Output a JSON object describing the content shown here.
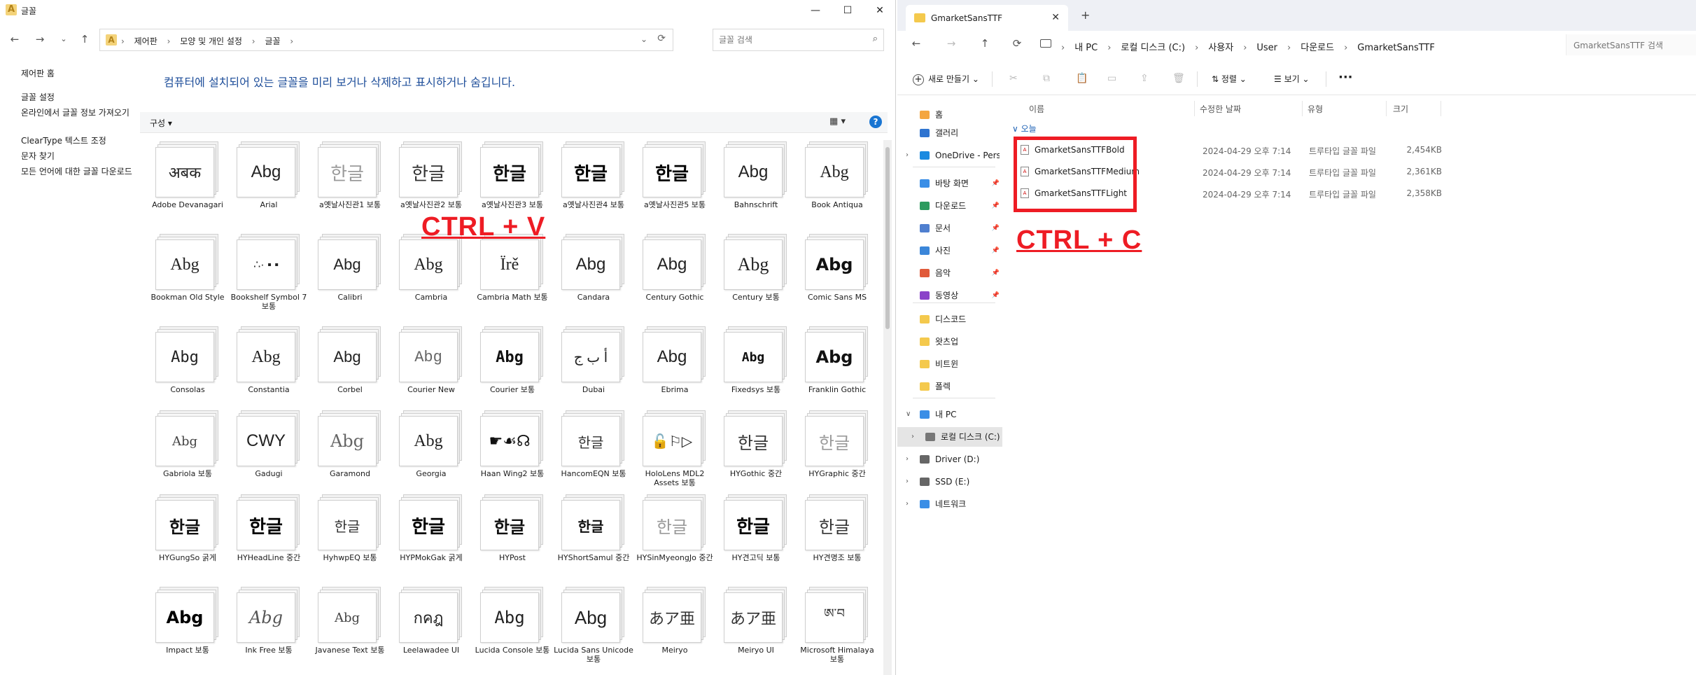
{
  "left_window": {
    "title": "글꼴",
    "buttons": {
      "minimize": "—",
      "maximize": "☐",
      "close": "✕"
    },
    "nav": {
      "back": "←",
      "forward": "→",
      "recent": "⌄",
      "up": "↑"
    },
    "address": {
      "crumbs": [
        "제어판",
        "모양 및 개인 설정",
        "글꼴"
      ],
      "separator": "›"
    },
    "search": {
      "placeholder": "글꼴 검색"
    },
    "sidebar": [
      "제어판 홈",
      "글꼴 설정",
      "온라인에서 글꼴 정보 가져오기",
      "ClearType 텍스트 조정",
      "문자 찾기",
      "모든 언어에 대한 글꼴 다운로드"
    ],
    "heading": "컴퓨터에 설치되어 있는 글꼴을 미리 보거나 삭제하고 표시하거나 숨깁니다.",
    "toolbar": {
      "organize": "구성 ▾",
      "view": "▦ ▾",
      "help": "?"
    },
    "fonts": [
      {
        "name": "Adobe Devanagari",
        "sample": "अबक",
        "style": "serif",
        "size": 22
      },
      {
        "name": "Arial",
        "sample": "Abg",
        "style": "sans",
        "size": 24
      },
      {
        "name": "a옛날사진관1 보통",
        "sample": "한글",
        "style": "light",
        "size": 26
      },
      {
        "name": "a옛날사진관2 보통",
        "sample": "한글",
        "style": "regular",
        "size": 26
      },
      {
        "name": "a옛날사진관3 보통",
        "sample": "한글",
        "style": "bold",
        "size": 26
      },
      {
        "name": "a옛날사진관4 보통",
        "sample": "한글",
        "style": "heavy",
        "size": 26
      },
      {
        "name": "a옛날사진관5 보통",
        "sample": "한글",
        "style": "heavy",
        "size": 26
      },
      {
        "name": "Bahnschrift",
        "sample": "Abg",
        "style": "sans",
        "size": 24
      },
      {
        "name": "Book Antiqua",
        "sample": "Abg",
        "style": "serif",
        "size": 24
      },
      {
        "name": "Bookman Old Style",
        "sample": "Abg",
        "style": "serif",
        "size": 24
      },
      {
        "name": "Bookshelf Symbol 7 보통",
        "sample": "∴·  ▪  ▪",
        "style": "sans",
        "size": 16
      },
      {
        "name": "Calibri",
        "sample": "Abg",
        "style": "sans",
        "size": 22
      },
      {
        "name": "Cambria",
        "sample": "Abg",
        "style": "serif",
        "size": 24
      },
      {
        "name": "Cambria Math 보통",
        "sample": "Ïrě",
        "style": "serif",
        "size": 24
      },
      {
        "name": "Candara",
        "sample": "Abg",
        "style": "sans",
        "size": 24
      },
      {
        "name": "Century Gothic",
        "sample": "Abg",
        "style": "sans",
        "size": 24
      },
      {
        "name": "Century 보통",
        "sample": "Abg",
        "style": "serif",
        "size": 26
      },
      {
        "name": "Comic Sans MS",
        "sample": "Abg",
        "style": "sans-bold",
        "size": 24
      },
      {
        "name": "Consolas",
        "sample": "Abg",
        "style": "mono",
        "size": 22
      },
      {
        "name": "Constantia",
        "sample": "Abg",
        "style": "serif",
        "size": 24
      },
      {
        "name": "Corbel",
        "sample": "Abg",
        "style": "sans",
        "size": 22
      },
      {
        "name": "Courier New",
        "sample": "Abg",
        "style": "mono-light",
        "size": 22
      },
      {
        "name": "Courier 보통",
        "sample": "Abg",
        "style": "mono-bold",
        "size": 22
      },
      {
        "name": "Dubai",
        "sample": "أ ب ج",
        "style": "sans",
        "size": 20
      },
      {
        "name": "Ebrima",
        "sample": "Abg",
        "style": "sans",
        "size": 24
      },
      {
        "name": "Fixedsys 보통",
        "sample": "Abg",
        "style": "mono-bold",
        "size": 18
      },
      {
        "name": "Franklin Gothic",
        "sample": "Abg",
        "style": "sans-bold",
        "size": 24
      },
      {
        "name": "Gabriola 보통",
        "sample": "Abg",
        "style": "serif-small",
        "size": 18
      },
      {
        "name": "Gadugi",
        "sample": "CWY",
        "style": "sans",
        "size": 24
      },
      {
        "name": "Garamond",
        "sample": "Abg",
        "style": "serif-light",
        "size": 24
      },
      {
        "name": "Georgia",
        "sample": "Abg",
        "style": "serif",
        "size": 24
      },
      {
        "name": "Haan Wing2 보통",
        "sample": "☛☙☊",
        "style": "sans-bold",
        "size": 22
      },
      {
        "name": "HancomEQN 보통",
        "sample": "한글",
        "style": "regular",
        "size": 20
      },
      {
        "name": "HoloLens MDL2 Assets 보통",
        "sample": "🔓⚐▷",
        "style": "sans",
        "size": 20
      },
      {
        "name": "HYGothic 중간",
        "sample": "한글",
        "style": "regular",
        "size": 24
      },
      {
        "name": "HYGraphic 중간",
        "sample": "한글",
        "style": "light",
        "size": 24
      },
      {
        "name": "HYGungSo 굵게",
        "sample": "한글",
        "style": "bold",
        "size": 24
      },
      {
        "name": "HYHeadLine 중간",
        "sample": "한글",
        "style": "heavy",
        "size": 26
      },
      {
        "name": "HyhwpEQ 보통",
        "sample": "한글",
        "style": "regular",
        "size": 20
      },
      {
        "name": "HYPMokGak 굵게",
        "sample": "한글",
        "style": "heavy",
        "size": 26
      },
      {
        "name": "HYPost",
        "sample": "한글",
        "style": "bold",
        "size": 24
      },
      {
        "name": "HYShortSamul 중간",
        "sample": "한글",
        "style": "bold",
        "size": 20
      },
      {
        "name": "HYSinMyeongJo 중간",
        "sample": "한글",
        "style": "light",
        "size": 24
      },
      {
        "name": "HY견고딕 보통",
        "sample": "한글",
        "style": "heavy",
        "size": 26
      },
      {
        "name": "HY견명조 보통",
        "sample": "한글",
        "style": "regular",
        "size": 24
      },
      {
        "name": "Impact 보통",
        "sample": "Abg",
        "style": "heavy",
        "size": 24
      },
      {
        "name": "Ink Free 보통",
        "sample": "Abg",
        "style": "italic-light",
        "size": 24
      },
      {
        "name": "Javanese Text 보통",
        "sample": "Abg",
        "style": "serif-small",
        "size": 18
      },
      {
        "name": "Leelawadee UI",
        "sample": "กคฎ",
        "style": "sans",
        "size": 22
      },
      {
        "name": "Lucida Console 보통",
        "sample": "Abg",
        "style": "mono",
        "size": 24
      },
      {
        "name": "Lucida Sans Unicode 보통",
        "sample": "Abg",
        "style": "sans",
        "size": 26
      },
      {
        "name": "Meiryo",
        "sample": "あア亜",
        "style": "regular",
        "size": 22
      },
      {
        "name": "Meiryo UI",
        "sample": "あア亜",
        "style": "regular",
        "size": 22
      },
      {
        "name": "Microsoft Himalaya 보통",
        "sample": "ཨ་བ",
        "style": "regular",
        "size": 18
      }
    ],
    "overlay_text": "CTRL + V"
  },
  "right_window": {
    "tab": {
      "title": "GmarketSansTTF",
      "close": "✕",
      "new_tab": "+"
    },
    "nav": {
      "back": "←",
      "forward": "→",
      "up": "↑",
      "refresh": "⟳"
    },
    "address": {
      "crumbs": [
        "내 PC",
        "로컬 디스크 (C:)",
        "사용자",
        "User",
        "다운로드",
        "GmarketSansTTF"
      ],
      "separator": "›"
    },
    "search": {
      "placeholder": "GmarketSansTTF 검색"
    },
    "cmdbar": {
      "new_label": "새로 만들기",
      "sort_label": "⇅ 정렬 ⌄",
      "view_label": "☰ 보기 ⌄",
      "more": "···"
    },
    "nav_items": [
      {
        "label": "홈",
        "color": "#f4a640",
        "pin": false,
        "chev": false
      },
      {
        "label": "갤러리",
        "color": "#2f74d0",
        "pin": false,
        "chev": false
      },
      {
        "label": "OneDrive - Personal",
        "color": "#1b8ae0",
        "pin": false,
        "chev": true
      },
      {
        "label": "바탕 화면",
        "color": "#3a8ee6",
        "pin": true,
        "chev": false
      },
      {
        "label": "다운로드",
        "color": "#2d9b5e",
        "pin": true,
        "chev": false
      },
      {
        "label": "문서",
        "color": "#4f7fcf",
        "pin": true,
        "chev": false
      },
      {
        "label": "사진",
        "color": "#3b86d9",
        "pin": true,
        "chev": false
      },
      {
        "label": "음악",
        "color": "#e05a3a",
        "pin": true,
        "chev": false
      },
      {
        "label": "동영상",
        "color": "#8a43c9",
        "pin": true,
        "chev": false
      },
      {
        "label": "디스코드",
        "color": "#f4c94d",
        "pin": false,
        "chev": false
      },
      {
        "label": "왓츠업",
        "color": "#f4c94d",
        "pin": false,
        "chev": false
      },
      {
        "label": "비트윈",
        "color": "#f4c94d",
        "pin": false,
        "chev": false
      },
      {
        "label": "폴렉",
        "color": "#f4c94d",
        "pin": false,
        "chev": false
      },
      {
        "label": "내 PC",
        "color": "#3a8ee6",
        "pin": false,
        "chev": true,
        "expanded": true
      },
      {
        "label": "로컬 디스크 (C:)",
        "color": "#777777",
        "pin": false,
        "chev": true,
        "selected": true
      },
      {
        "label": "Driver (D:)",
        "color": "#666666",
        "pin": false,
        "chev": true
      },
      {
        "label": "SSD (E:)",
        "color": "#666666",
        "pin": false,
        "chev": true
      },
      {
        "label": "네트워크",
        "color": "#3a8ee6",
        "pin": false,
        "chev": true
      }
    ],
    "columns": [
      "이름",
      "수정한 날짜",
      "유형",
      "크기"
    ],
    "group_label": "∨ 오늘",
    "files": [
      {
        "name": "GmarketSansTTFBold",
        "date": "2024-04-29 오후 7:14",
        "type": "트루타입 글꼴 파일",
        "size": "2,454KB"
      },
      {
        "name": "GmarketSansTTFMedium",
        "date": "2024-04-29 오후 7:14",
        "type": "트루타입 글꼴 파일",
        "size": "2,361KB"
      },
      {
        "name": "GmarketSansTTFLight",
        "date": "2024-04-29 오후 7:14",
        "type": "트루타입 글꼴 파일",
        "size": "2,358KB"
      }
    ],
    "overlay_text": "CTRL + C"
  },
  "colors": {
    "accent_red": "#ee1c24",
    "link_blue": "#1e4e9a",
    "folder_yellow": "#f4c94d"
  }
}
